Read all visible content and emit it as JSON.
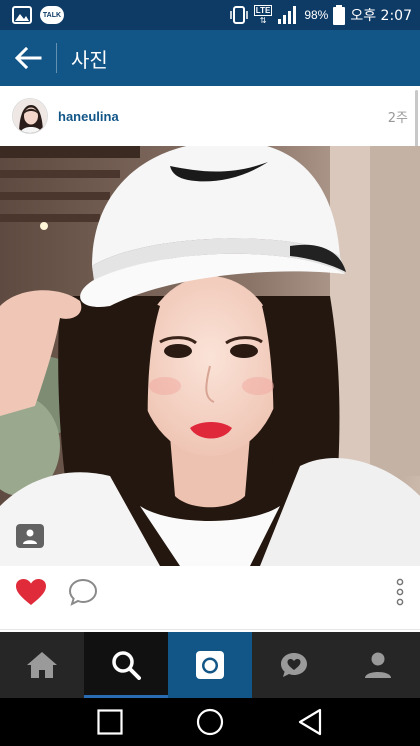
{
  "status_bar": {
    "talk_badge": "TALK",
    "network": "LTE",
    "battery": "98%",
    "time": "오후 2:07"
  },
  "action_bar": {
    "title": "사진"
  },
  "post": {
    "username": "haneulina",
    "time_ago": "2주"
  },
  "colors": {
    "status_bar": "#0e3a66",
    "action_bar": "#125688",
    "like": "#e02c3a",
    "tab_bar": "#262626",
    "active_indicator": "#2a6cb4"
  },
  "tabs": [
    {
      "icon": "home-icon"
    },
    {
      "icon": "search-icon",
      "active": true
    },
    {
      "icon": "camera-icon"
    },
    {
      "icon": "activity-heart-icon"
    },
    {
      "icon": "profile-icon"
    }
  ],
  "nav": [
    "recent-apps-icon",
    "home-circle-icon",
    "back-triangle-icon"
  ]
}
